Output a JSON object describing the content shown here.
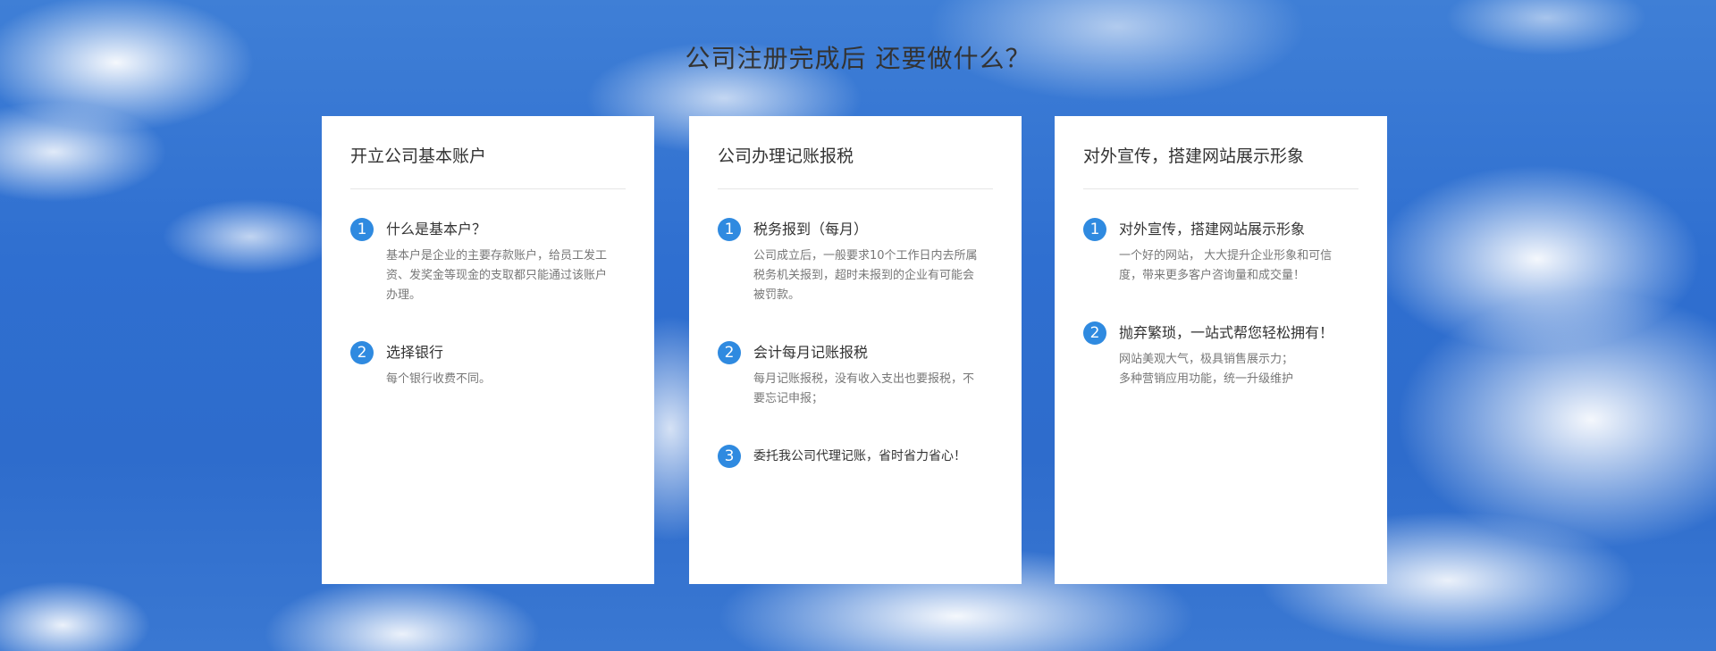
{
  "page_title": "公司注册完成后 还要做什么？",
  "cards": [
    {
      "title": "开立公司基本账户",
      "items": [
        {
          "num": "1",
          "title": "什么是基本户？",
          "desc": [
            "基本户是企业的主要存款账户，给员工发工",
            "资、发奖金等现金的支取都只能通过该账户",
            "办理。"
          ]
        },
        {
          "num": "2",
          "title": "选择银行",
          "desc": [
            "每个银行收费不同。"
          ]
        }
      ]
    },
    {
      "title": "公司办理记账报税",
      "items": [
        {
          "num": "1",
          "title": "税务报到（每月）",
          "desc": [
            "公司成立后，一般要求10个工作日内去所属",
            "税务机关报到，超时未报到的企业有可能会",
            "被罚款。"
          ]
        },
        {
          "num": "2",
          "title": "会计每月记账报税",
          "desc": [
            "每月记账报税，没有收入支出也要报税，不",
            "要忘记申报；"
          ]
        },
        {
          "num": "3",
          "title": "委托我公司代理记账，省时省力省心！",
          "desc": []
        }
      ]
    },
    {
      "title": "对外宣传，搭建网站展示形象",
      "items": [
        {
          "num": "1",
          "title": "对外宣传，搭建网站展示形象",
          "desc": [
            "一个好的网站， 大大提升企业形象和可信",
            "度，带来更多客户咨询量和成交量！"
          ]
        },
        {
          "num": "2",
          "title": "抛弃繁琐，一站式帮您轻松拥有！",
          "desc": [
            "网站美观大气，极具销售展示力；",
            "多种营销应用功能，统一升级维护"
          ]
        }
      ]
    }
  ],
  "colors": {
    "accent": "#2f8ae0",
    "sky": "#2f6fd0"
  }
}
